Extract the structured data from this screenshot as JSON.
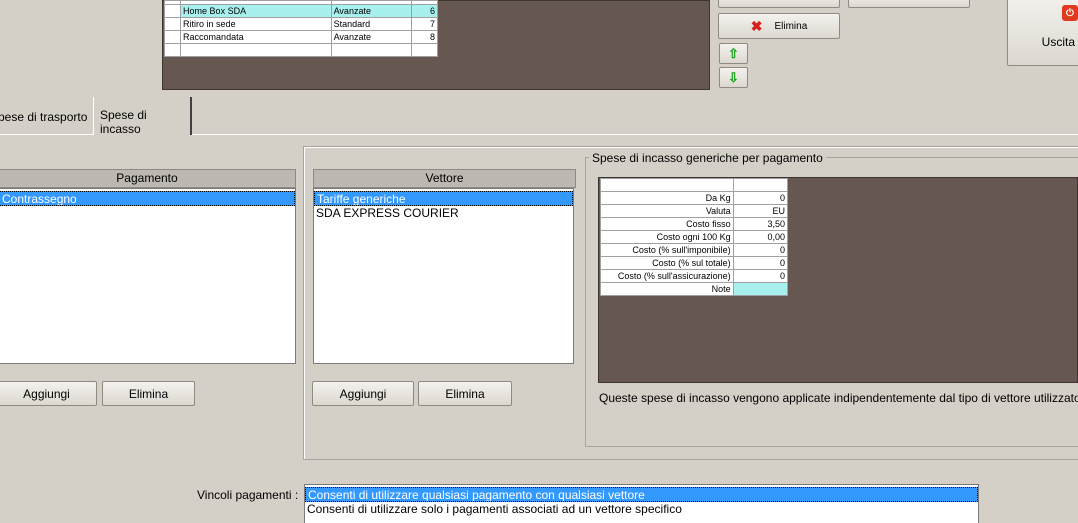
{
  "top_table": {
    "rows": [
      {
        "name": "Home Box SDA",
        "type": "Avanzate",
        "num": "6",
        "highlight": true
      },
      {
        "name": "Ritiro in sede",
        "type": "Standard",
        "num": "7",
        "highlight": false
      },
      {
        "name": "Raccomandata",
        "type": "Avanzate",
        "num": "8",
        "highlight": false
      }
    ]
  },
  "right_buttons": {
    "delete_label": "Elimina",
    "exit_label": "Uscita ("
  },
  "tabs": [
    {
      "label": "pese di trasporto",
      "active": false
    },
    {
      "label": "Spese di incasso",
      "active": true
    }
  ],
  "pagamento": {
    "header": "Pagamento",
    "items": [
      "Contrassegno"
    ],
    "add_label": "Aggiungi",
    "delete_label": "Elimina"
  },
  "vettore": {
    "header": "Vettore",
    "items": [
      "Tariffe generiche",
      "SDA EXPRESS COURIER"
    ],
    "add_label": "Aggiungi",
    "delete_label": "Elimina"
  },
  "spese_group": {
    "title": "Spese di incasso generiche per pagamento",
    "rows": [
      {
        "label": "Da Kg",
        "value": "0"
      },
      {
        "label": "Valuta",
        "value": "EU"
      },
      {
        "label": "Costo fisso",
        "value": "3,50"
      },
      {
        "label": "Costo ogni 100 Kg",
        "value": "0,00"
      },
      {
        "label": "Costo (% sull'imponibile)",
        "value": "0"
      },
      {
        "label": "Costo (% sul totale)",
        "value": "0"
      },
      {
        "label": "Costo (% sull'assicurazione)",
        "value": "0"
      },
      {
        "label": "Note",
        "value": ""
      }
    ],
    "note": "Queste spese di incasso vengono applicate indipendentemente dal tipo di vettore utilizzato."
  },
  "vincoli": {
    "label": "Vincoli pagamenti :",
    "options": [
      "Consenti di utilizzare qualsiasi pagamento con qualsiasi vettore",
      "Consenti di utilizzare solo i pagamenti associati ad un vettore specifico"
    ]
  },
  "colors": {
    "grid_dark": "#665750",
    "highlight_cell": "#a8f0ee",
    "selection": "#3399ff"
  }
}
